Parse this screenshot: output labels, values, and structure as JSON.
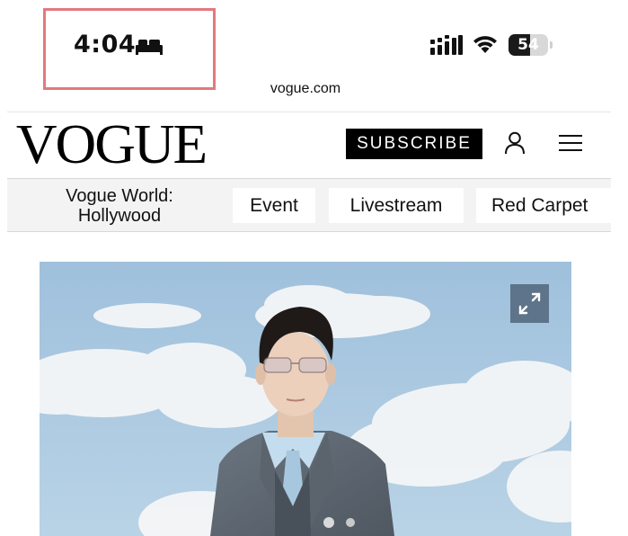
{
  "status_bar": {
    "time": "4:04",
    "focus_icon": "bed-icon",
    "signal_icon": "cellular-signal-icon",
    "wifi_icon": "wifi-icon",
    "battery_level": "54",
    "battery_fraction": 0.54
  },
  "browser": {
    "url": "vogue.com"
  },
  "header": {
    "logo": "VOGUE",
    "subscribe_label": "SUBSCRIBE",
    "account_icon": "user-icon",
    "menu_icon": "hamburger-menu-icon"
  },
  "nav": {
    "items": [
      {
        "label_line1": "Vogue World:",
        "label_line2": "Hollywood"
      },
      {
        "label": "Event"
      },
      {
        "label": "Livestream"
      },
      {
        "label": "Red Carpet"
      }
    ]
  },
  "hero": {
    "image": "photo-of-man-in-grey-suit-against-sky",
    "expand_icon": "expand-icon",
    "colors": {
      "sky": "#a9c6de",
      "suit": "#5d6670",
      "shirt": "#bcd7ea"
    }
  },
  "colors": {
    "highlight_box": "#e07a7e",
    "subscribe_bg": "#000000",
    "nav_bg": "#f3f3f3"
  }
}
